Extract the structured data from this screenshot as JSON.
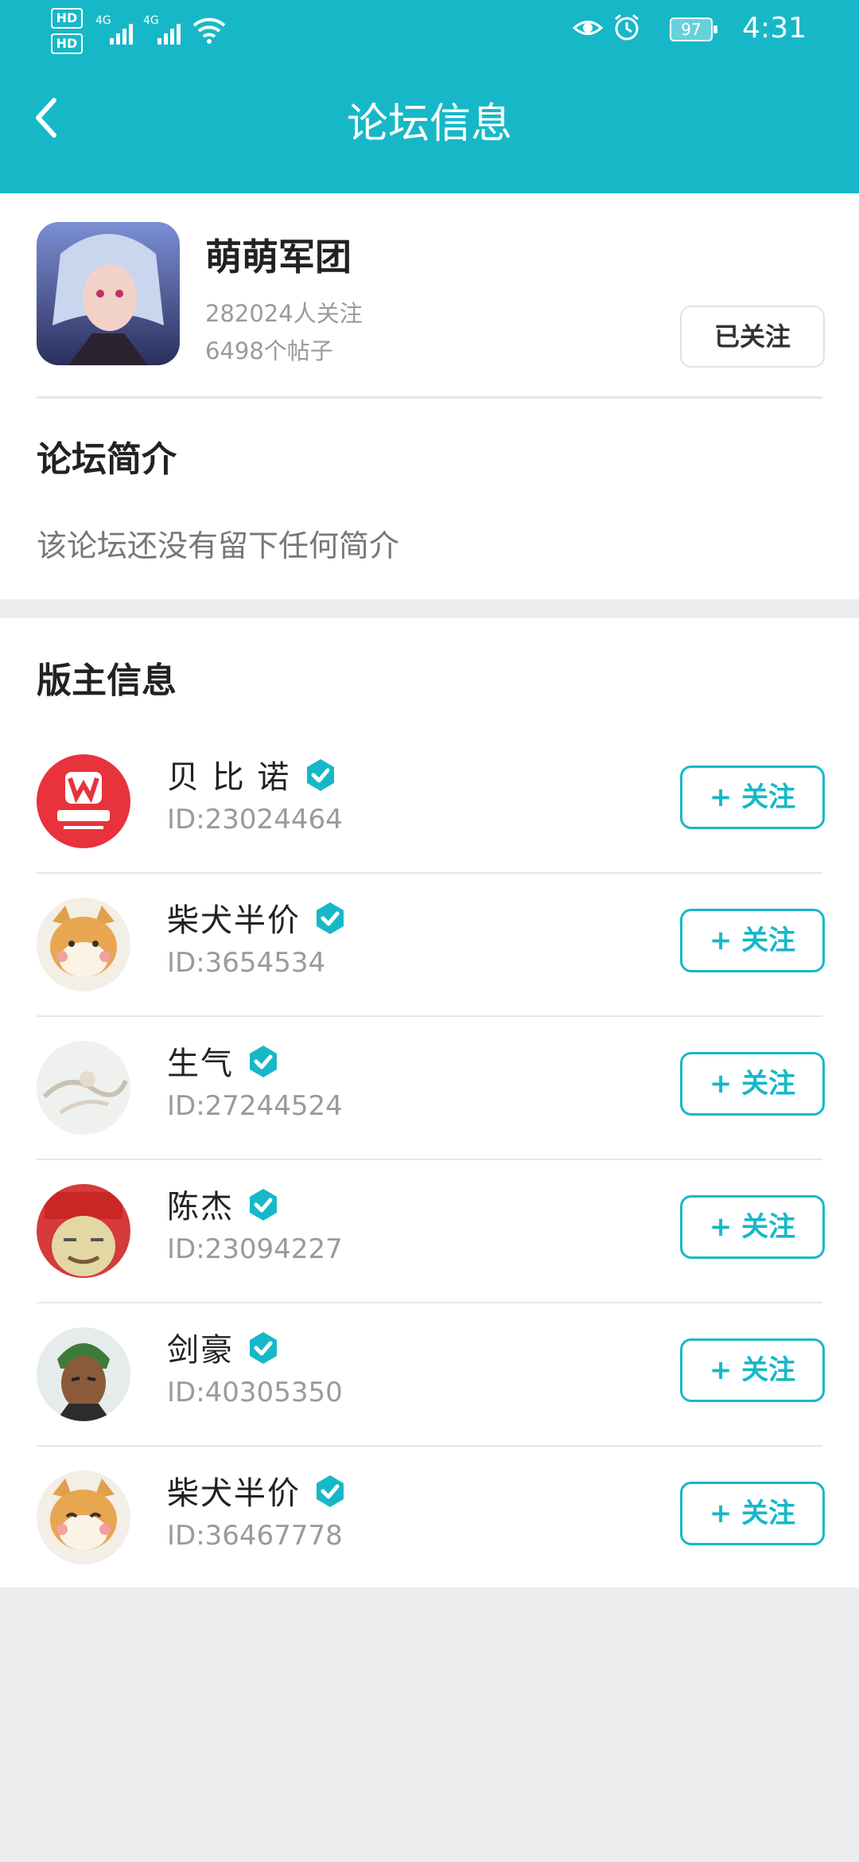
{
  "status_bar": {
    "hd1": "HD",
    "hd2": "HD",
    "net1": "4G",
    "net2": "4G",
    "battery": "97",
    "time": "4:31",
    "icons": [
      "signal-icon",
      "wifi-icon",
      "eye-icon",
      "alarm-icon",
      "battery-icon"
    ]
  },
  "header": {
    "title": "论坛信息",
    "back_icon": "back-chevron-icon"
  },
  "forum": {
    "name": "萌萌军团",
    "followers": "282024人关注",
    "posts": "6498个帖子",
    "followed_label": "已关注"
  },
  "intro": {
    "title": "论坛简介",
    "text": "该论坛还没有留下任何简介"
  },
  "moderators": {
    "title": "版主信息",
    "follow_label": "+ 关注",
    "items": [
      {
        "name": "贝 比 诺",
        "id": "ID:23024464"
      },
      {
        "name": "柴犬半价",
        "id": "ID:3654534"
      },
      {
        "name": "生气",
        "id": "ID:27244524"
      },
      {
        "name": "陈杰",
        "id": "ID:23094227"
      },
      {
        "name": "剑豪",
        "id": "ID:40305350"
      },
      {
        "name": "柴犬半价",
        "id": "ID:36467778"
      }
    ]
  },
  "colors": {
    "accent": "#16b8c8",
    "page_bg": "#ededed"
  }
}
